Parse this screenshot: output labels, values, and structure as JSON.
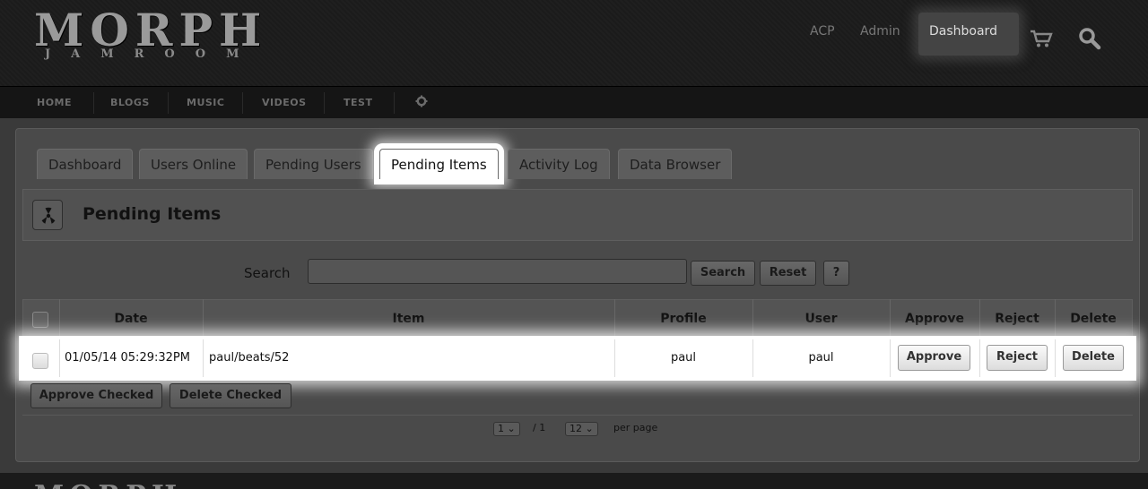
{
  "header": {
    "logo_main": "MORPH",
    "logo_sub": "JAMROOM",
    "nav_acp": "ACP",
    "nav_admin": "Admin",
    "nav_dashboard": "Dashboard"
  },
  "mainnav": {
    "items": [
      "HOME",
      "BLOGS",
      "MUSIC",
      "VIDEOS",
      "TEST"
    ]
  },
  "tabs": [
    "Dashboard",
    "Users Online",
    "Pending Users",
    "Pending Items",
    "Activity Log",
    "Data Browser"
  ],
  "page": {
    "title": "Pending Items"
  },
  "search": {
    "label": "Search",
    "value": "",
    "search_button": "Search",
    "reset_button": "Reset",
    "help_button": "?"
  },
  "table": {
    "headers": [
      "Date",
      "Item",
      "Profile",
      "User",
      "Approve",
      "Reject",
      "Delete"
    ],
    "rows": [
      {
        "date": "01/05/14 05:29:32PM",
        "item": "paul/beats/52",
        "profile": "paul",
        "user": "paul",
        "approve": "Approve",
        "reject": "Reject",
        "delete": "Delete"
      }
    ]
  },
  "bulk": {
    "approve_checked": "Approve Checked",
    "delete_checked": "Delete Checked"
  },
  "pager": {
    "page": "1",
    "of": "/ 1",
    "per_page_value": "12",
    "per_page_label": "per page"
  },
  "footer": {
    "logo": "MORPH"
  },
  "colors": {
    "header_bg": "#1b1b1b",
    "overlay_bg": "#3a3a3a",
    "highlight": "#ffffff"
  }
}
